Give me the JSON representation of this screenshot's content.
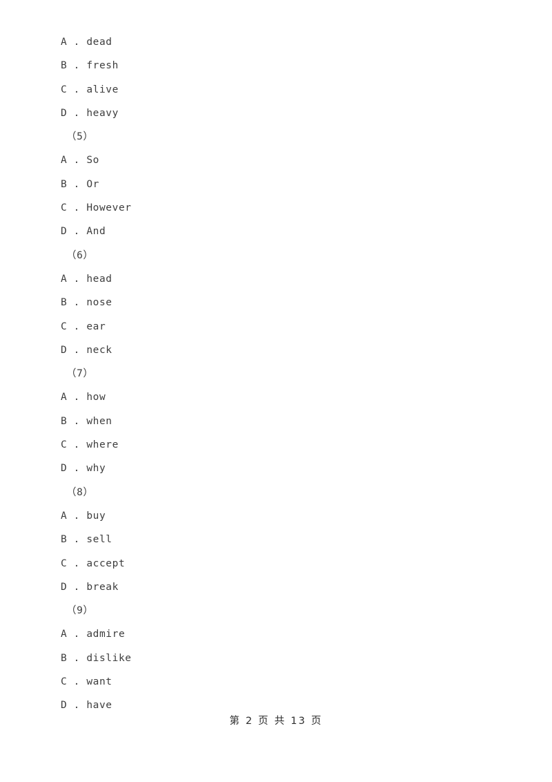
{
  "document": {
    "page_background": "#ffffff",
    "text_color": "#3d3d3d"
  },
  "body_lines": [
    {
      "kind": "option",
      "text": "A . dead"
    },
    {
      "kind": "option",
      "text": "B . fresh"
    },
    {
      "kind": "option",
      "text": "C . alive"
    },
    {
      "kind": "option",
      "text": "D . heavy"
    },
    {
      "kind": "qnum",
      "text": "（5）"
    },
    {
      "kind": "option",
      "text": "A . So"
    },
    {
      "kind": "option",
      "text": "B . Or"
    },
    {
      "kind": "option",
      "text": "C . However"
    },
    {
      "kind": "option",
      "text": "D . And"
    },
    {
      "kind": "qnum",
      "text": "（6）"
    },
    {
      "kind": "option",
      "text": "A . head"
    },
    {
      "kind": "option",
      "text": "B . nose"
    },
    {
      "kind": "option",
      "text": "C . ear"
    },
    {
      "kind": "option",
      "text": "D . neck"
    },
    {
      "kind": "qnum",
      "text": "（7）"
    },
    {
      "kind": "option",
      "text": "A . how"
    },
    {
      "kind": "option",
      "text": "B . when"
    },
    {
      "kind": "option",
      "text": "C . where"
    },
    {
      "kind": "option",
      "text": "D . why"
    },
    {
      "kind": "qnum",
      "text": "（8）"
    },
    {
      "kind": "option",
      "text": "A . buy"
    },
    {
      "kind": "option",
      "text": "B . sell"
    },
    {
      "kind": "option",
      "text": "C . accept"
    },
    {
      "kind": "option",
      "text": "D . break"
    },
    {
      "kind": "qnum",
      "text": "（9）"
    },
    {
      "kind": "option",
      "text": "A . admire"
    },
    {
      "kind": "option",
      "text": "B . dislike"
    },
    {
      "kind": "option",
      "text": "C . want"
    },
    {
      "kind": "option",
      "text": "D . have"
    }
  ],
  "footer": {
    "page_label": "第 2 页 共 13 页",
    "current_page": "2",
    "total_pages": "13"
  }
}
